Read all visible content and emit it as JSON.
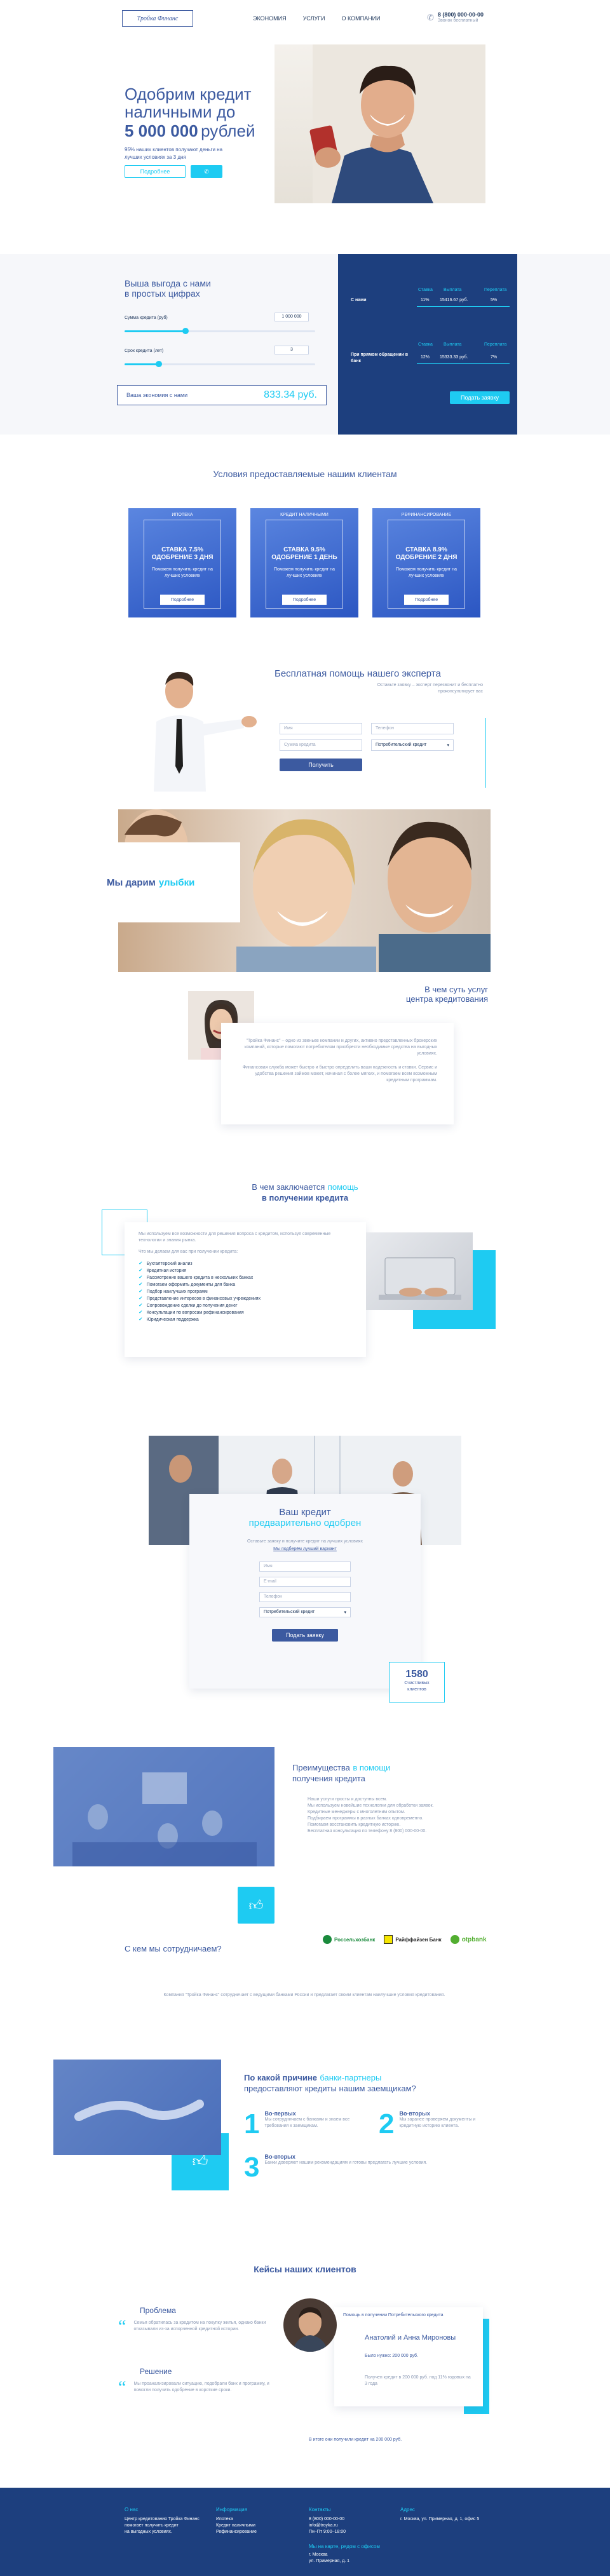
{
  "header": {
    "logo": "Тройка Финанс",
    "nav": [
      "ЭКОНОМИЯ",
      "УСЛУГИ",
      "О КОМПАНИИ"
    ],
    "phone": "8 (800) 000-00-00",
    "phone_sub": "Звонок бесплатный"
  },
  "hero": {
    "title_line1": "Одобрим кредит",
    "title_line2": "наличными до",
    "amount": "5 000 000",
    "currency": "рублей",
    "subtitle": "95% наших клиентов получают деньги на лучших условиях за 3 дня",
    "btn_more": "Подробнее",
    "btn_call": "✆"
  },
  "calc": {
    "title_line1": "Выша выгода с нами",
    "title_line2": "в простых цифрах",
    "amount_label": "Сумма кредита (руб)",
    "amount_value": "1 000 000",
    "amount_fill": 0.32,
    "term_label": "Срок кредита (лет)",
    "term_value": "3",
    "term_fill": 0.18,
    "savings_label": "Ваша экономия с нами",
    "savings_value": "833.34 руб.",
    "rows": [
      {
        "name": "С нами",
        "rate_head": "Ставка",
        "rate": "11%",
        "pay_head": "Выплата",
        "pay": "15416.67 руб.",
        "over_head": "Переплата",
        "over": "5%"
      },
      {
        "name": "При прямом обращении в банк",
        "rate_head": "Ставка",
        "rate": "12%",
        "pay_head": "Выплата",
        "pay": "15333.33 руб.",
        "over_head": "Переплата",
        "over": "7%"
      }
    ],
    "apply_btn": "Подать заявку"
  },
  "offers": {
    "title": "Условия предоставляемые нашим клиентам",
    "cards": [
      {
        "tag": "ИПОТЕКА",
        "line1": "СТАВКА 7.5%",
        "line2": "ОДОБРЕНИЕ 3 ДНЯ",
        "desc": "Поможем получить кредит на лучших условиях",
        "btn": "Подробнее"
      },
      {
        "tag": "КРЕДИТ НАЛИЧНЫМИ",
        "line1": "СТАВКА 9.5%",
        "line2": "ОДОБРЕНИЕ 1 ДЕНЬ",
        "desc": "Поможем получить кредит на лучших условиях",
        "btn": "Подробнее"
      },
      {
        "tag": "РЕФИНАНСИРОВАНИЕ",
        "line1": "СТАВКА 8.9%",
        "line2": "ОДОБРЕНИЕ 2 ДНЯ",
        "desc": "Поможем получить кредит на лучших условиях",
        "btn": "Подробнее"
      }
    ]
  },
  "expert": {
    "title": "Бесплатная помощь нашего эксперта",
    "desc": "Оставьте заявку – эксперт перезвонит и бесплатно проконсультирует вас",
    "field_name": "Имя",
    "field_phone": "Телефон",
    "field_amount": "Сумма кредита",
    "field_type": "Потребительский кредит",
    "btn": "Получить"
  },
  "smiles": {
    "title_a": "Мы дарим",
    "title_b": "улыбки"
  },
  "essence": {
    "title_a": "В чем суть услуг",
    "title_b": "центра кредитования",
    "text1": "\"Тройка Финанс\" – одно из звеньев компании и других, активно представленных брокерских компаний, которые помогают потребителям приобрести необходимые средства на выгодных условиях.",
    "text2": "Финансовая служба может быстро и быстро определить ваши надежность и ставки. Сервис и удобства решения займов может, начиная с более мягких, и помогаем всем возможным кредитным программам."
  },
  "help": {
    "title_a": "В чем заключается",
    "title_b": "помощь",
    "title_c": "в получении кредита",
    "intro": "Мы используем все возможности для решения вопроса с кредитом, используя современные технологии и знания рынка.",
    "intro2": "Что мы делаем для вас при получении кредита:",
    "items": [
      "Бухгалтерский анализ",
      "Кредитная история",
      "Рассмотрение вашего кредита в нескольких банках",
      "Помогаем оформить документы для банка",
      "Подбор наилучших программ",
      "Представление интересов в финансовых учреждениях",
      "Сопровождение сделки до получения денег",
      "Консультации по вопросам рефинансирования",
      "Юридическая поддержка"
    ]
  },
  "approved": {
    "title_a": "Ваш кредит",
    "title_b": "предварительно одобрен",
    "desc": "Оставьте заявку и получите кредит на лучших условиях",
    "link": "Мы подберём лучший вариант",
    "field_name": "Имя",
    "field_email": "E-mail",
    "field_phone": "Телефон",
    "field_type": "Потребительский кредит",
    "btn": "Подать заявку",
    "counter": "1580",
    "counter_label": "Счастливых клиентов"
  },
  "advantages": {
    "title_a": "Преимущества",
    "title_b": "в помощи",
    "title_c": "получения кредита",
    "lines": [
      "Наши услуги просты и доступны всем.",
      "Мы используем новейшие технологии для обработки заявок.",
      "Кредитные менеджеры с многолетним опытом.",
      "Подбираем программы в разных банках одновременно.",
      "Помогаем восстановить кредитную историю.",
      "Бесплатная консультация по телефону 8 (800) 000-00-00."
    ],
    "partners_q": "С кем мы сотрудничаем?",
    "partners": [
      "Россельхозбанк",
      "Райффайзен Банк",
      "otpbank"
    ],
    "note": "Компания \"Тройка Финанс\" сотрудничает с ведущими банками России и предлагает своим клиентам наилучшие условия кредитования."
  },
  "reasons": {
    "title_a": "По какой причине",
    "title_b": "банки-партнеры",
    "title_c": "предоставляют кредиты нашим заемщикам?",
    "items": [
      {
        "num": "1",
        "head": "Во-первых",
        "text": "Мы сотрудничаем с банками и знаем все требования к заемщикам."
      },
      {
        "num": "2",
        "head": "Во-вторых",
        "text": "Мы заранее проверяем документы и кредитную историю клиента."
      },
      {
        "num": "3",
        "head": "Во-вторых",
        "text": "Банки доверяют нашим рекомендациям и готовы предлагать лучшие условия."
      }
    ]
  },
  "cases": {
    "title": "Кейсы наших клиентов",
    "problem_head": "Проблема",
    "problem_text": "Семья обратилась за кредитом на покупку жилья, однако банки отказывали из-за испорченной кредитной истории.",
    "solution_head": "Решение",
    "solution_text": "Мы проанализировали ситуацию, подобрали банк и программу, и помогли получить одобрение в короткие сроки.",
    "client_tag": "Помощь в получении Потребительского кредита",
    "client_name": "Анатолий и Анна Мироновы",
    "client_amount": "Было нужно: 200 000 руб.",
    "client_result": "Получен кредит в 200 000 руб. под 11% годовых на 3 года",
    "footer_line": "В итоге они получили кредит на 200 000 руб."
  },
  "footer": {
    "cols": [
      {
        "head": "О нас",
        "lines": [
          "Центр кредитования Тройка Финанс",
          "помогает получить кредит",
          "на выгодных условиях."
        ]
      },
      {
        "head": "Информация",
        "lines": [
          "Ипотека",
          "Кредит наличными",
          "Рефинансирование"
        ]
      },
      {
        "head": "Контакты",
        "lines": [
          "8 (800) 000-00-00",
          "info@troyka.ru",
          "Пн–Пт 9:00–18:00"
        ]
      },
      {
        "head": "Мы на карте, рядом с офисом",
        "lines": [
          "г. Москва",
          "ул. Примерная, д. 1"
        ]
      },
      {
        "head": "Адрес",
        "lines": [
          "г. Москва, ул. Примерная, д. 1, офис 5"
        ]
      }
    ],
    "colors": {
      "accent": "#1ecbf2",
      "dark": "#1d3f7e",
      "brand": "#3c5aa0"
    }
  }
}
